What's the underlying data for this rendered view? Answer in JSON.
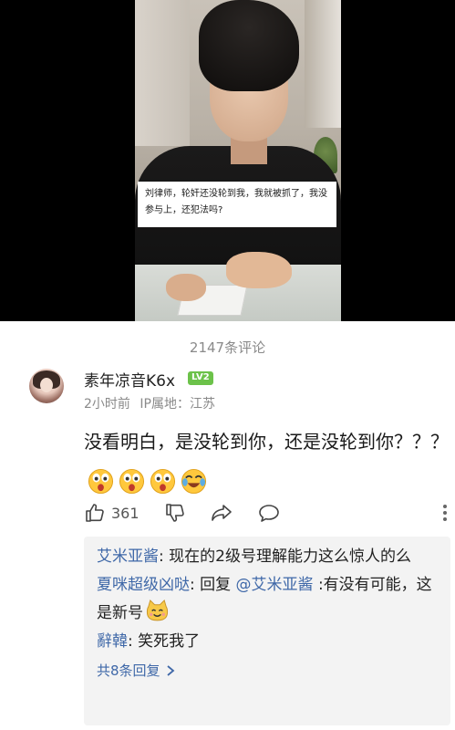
{
  "video": {
    "caption": "刘律师，轮奸还没轮到我，我就被抓了，我没参与上，还犯法吗?"
  },
  "comments": {
    "count_label": "2147条评论",
    "main": {
      "username": "素年凉音K6x",
      "level_badge": "LV2",
      "time": "2小时前",
      "ip_location": "IP属地：江苏",
      "text": "没看明白，是没轮到你，还是没轮到你？？？",
      "emojis": [
        "shocked-face-emoji",
        "shocked-face-emoji",
        "shocked-face-emoji",
        "crying-laughing-emoji"
      ],
      "like_count": "361",
      "icons": [
        "thumbs-up-icon",
        "thumbs-down-icon",
        "share-icon",
        "comment-icon",
        "more-vertical-icon"
      ]
    },
    "replies": [
      {
        "name": "艾米亚酱",
        "separator": ": ",
        "text": "现在的2级号理解能力这么惊人的么"
      },
      {
        "name": "夏咪超级凶哒",
        "separator": ": ",
        "prefix": "回复 ",
        "mention": "@艾米亚酱",
        "text": " :有没有可能，这是新号",
        "emoji": "cat-face-emoji"
      },
      {
        "name": "辭韓",
        "separator": ": ",
        "text": "笑死我了"
      }
    ],
    "more_replies_label": "共8条回复",
    "more_replies_icon": "chevron-right-icon"
  },
  "colors": {
    "link": "#3f68a8",
    "meta": "#8a8a8a",
    "level_badge": "#6cc24a",
    "reply_bg": "#f3f3f3"
  }
}
